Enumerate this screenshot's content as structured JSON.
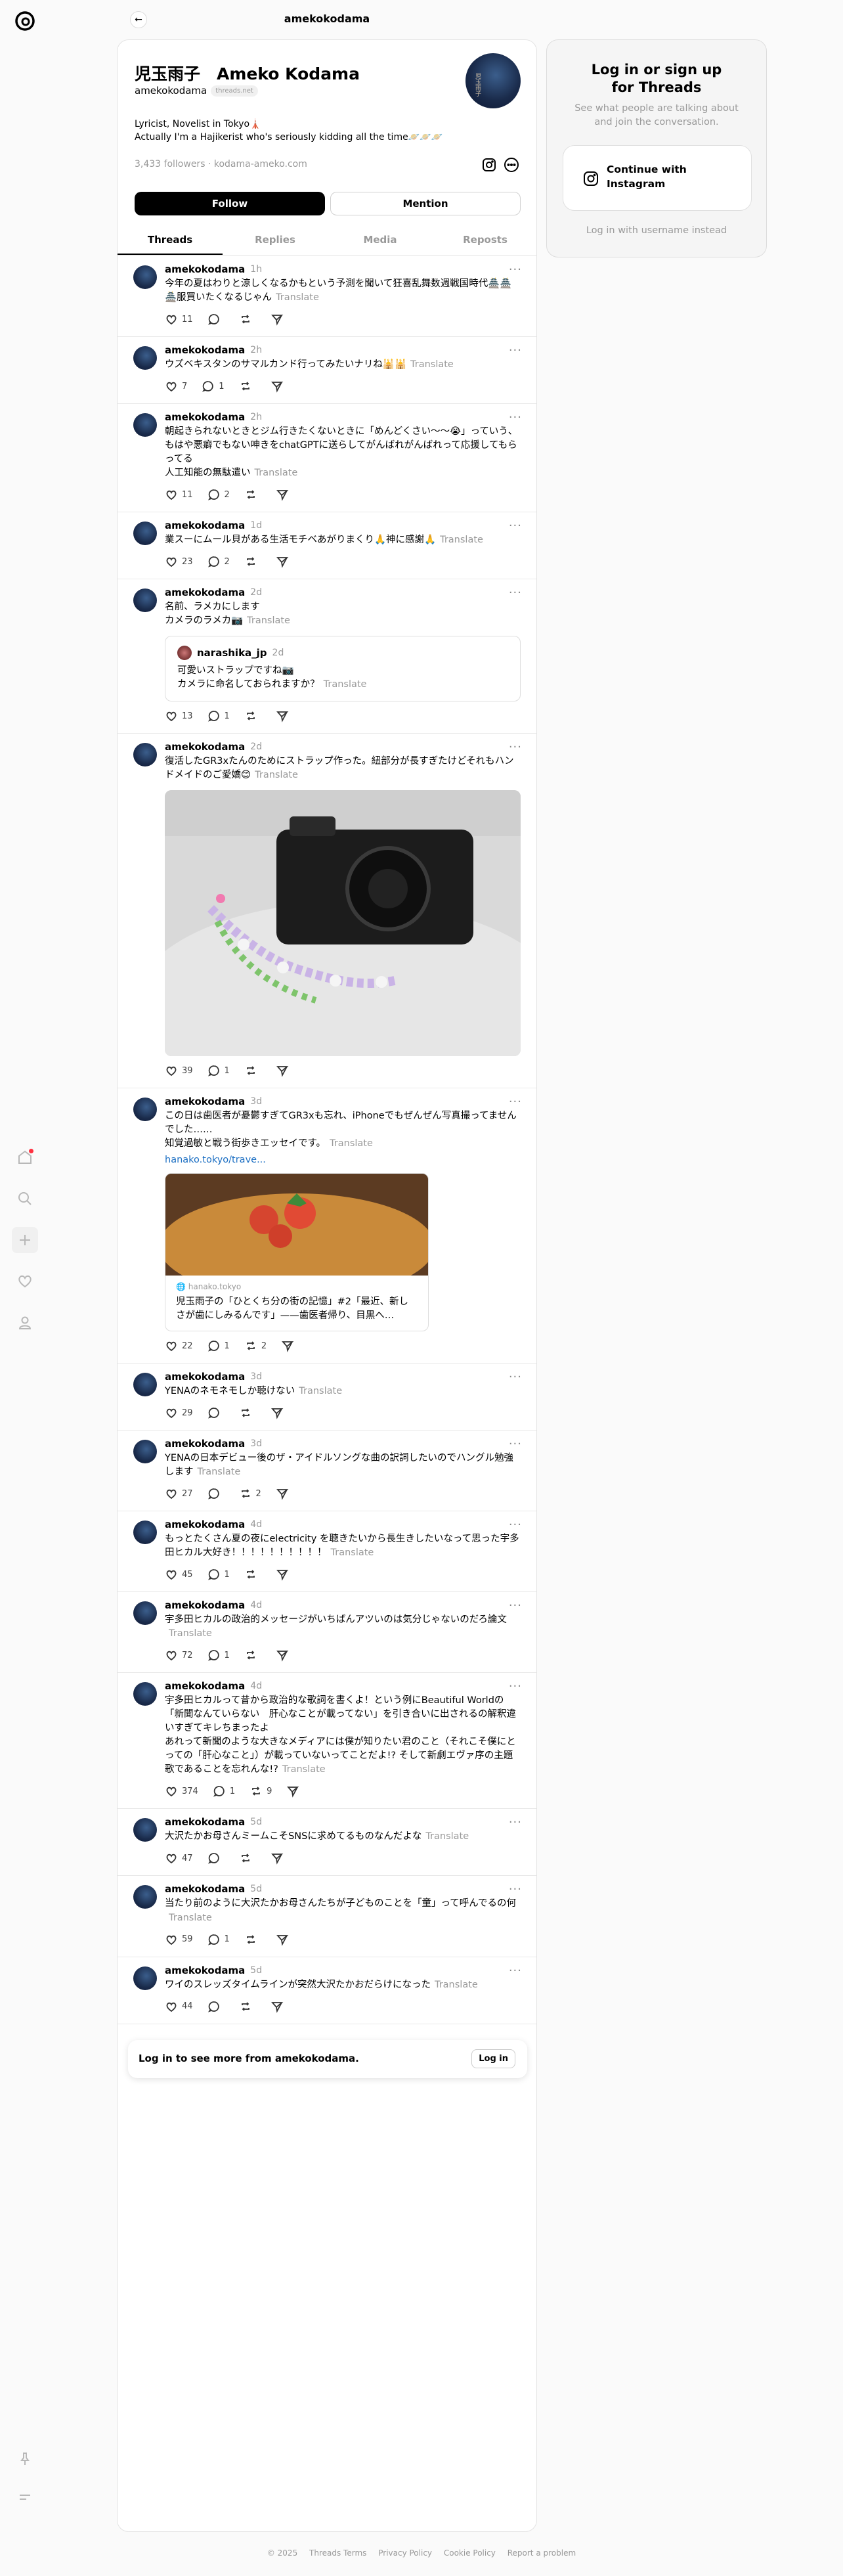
{
  "topbar": {
    "title": "amekokodama"
  },
  "profile": {
    "name": "児玉雨子　Ameko Kodama",
    "username": "amekokodama",
    "badge": "threads.net",
    "bio_line1": "Lyricist, Novelist in Tokyo🗼",
    "bio_line2": "Actually I'm a Hajikerist who's seriously kidding all the time🪐🪐🪐",
    "followers": "3,433 followers",
    "website": "kodama-ameko.com",
    "follow_label": "Follow",
    "mention_label": "Mention"
  },
  "tabs": [
    "Threads",
    "Replies",
    "Media",
    "Reposts"
  ],
  "translate_label": "Translate",
  "posts": [
    {
      "user": "amekokodama",
      "time": "1h",
      "text": "今年の夏はわりと涼しくなるかもという予測を聞いて狂喜乱舞数週戦国時代🏯🏯🏯服買いたくなるじゃん",
      "likes": "11",
      "replies": "",
      "reposts": ""
    },
    {
      "user": "amekokodama",
      "time": "2h",
      "text": "ウズベキスタンのサマルカンド行ってみたいナリね🕌🕌",
      "likes": "7",
      "replies": "1",
      "reposts": ""
    },
    {
      "user": "amekokodama",
      "time": "2h",
      "text": "朝起きられないときとジム行きたくないときに「めんどくさい〜〜😭」っていう、もはや悪癖でもない呻きをchatGPTに送らしてがんばれがんばれって応援してもらってる\n人工知能の無駄遣い",
      "likes": "11",
      "replies": "2",
      "reposts": ""
    },
    {
      "user": "amekokodama",
      "time": "1d",
      "text": "業スーにムール貝がある生活モチベあがりまくり🙏神に感謝🙏",
      "likes": "23",
      "replies": "2",
      "reposts": ""
    },
    {
      "user": "amekokodama",
      "time": "2d",
      "text": "名前、ラメカにします\nカメラのラメカ📷",
      "likes": "13",
      "replies": "1",
      "reposts": "",
      "quote": {
        "user": "narashika_jp",
        "time": "2d",
        "text": "可愛いストラップですね📷\nカメラに命名しておられますか？"
      }
    },
    {
      "user": "amekokodama",
      "time": "2d",
      "text": "復活したGR3xたんのためにストラップ作った。紐部分が長すぎたけどそれもハンドメイドのご愛嬌😊",
      "likes": "39",
      "replies": "1",
      "reposts": "",
      "photo": true
    },
    {
      "user": "amekokodama",
      "time": "3d",
      "text": "この日は歯医者が憂鬱すぎてGR3xも忘れ、iPhoneでもぜんぜん写真撮ってませんでした……\n知覚過敏と戦う街歩きエッセイです。",
      "likes": "22",
      "replies": "1",
      "reposts": "2",
      "link": "hanako.tokyo/trave...",
      "card": {
        "source": "hanako.tokyo",
        "title": "児玉雨子の「ひとくち分の街の記憶」#2「最近、新しさが歯にしみるんです」——歯医者帰り、目黒へ…"
      }
    },
    {
      "user": "amekokodama",
      "time": "3d",
      "text": "YENAのネモネモしか聴けない",
      "likes": "29",
      "replies": "",
      "reposts": ""
    },
    {
      "user": "amekokodama",
      "time": "3d",
      "text": "YENAの日本デビュー後のザ・アイドルソングな曲の訳詞したいのでハングル勉強します",
      "likes": "27",
      "replies": "",
      "reposts": "2"
    },
    {
      "user": "amekokodama",
      "time": "4d",
      "text": "もっとたくさん夏の夜にelectricity を聴きたいから長生きしたいなって思った宇多田ヒカル大好き！！！！！！！！！！",
      "likes": "45",
      "replies": "1",
      "reposts": ""
    },
    {
      "user": "amekokodama",
      "time": "4d",
      "text": "宇多田ヒカルの政治的メッセージがいちばんアツいのは気分じゃないのだろ論文",
      "likes": "72",
      "replies": "1",
      "reposts": ""
    },
    {
      "user": "amekokodama",
      "time": "4d",
      "text": "宇多田ヒカルって昔から政治的な歌詞を書くよ！という例にBeautiful Worldの「新聞なんていらない　肝心なことが載ってない」を引き合いに出されるの解釈違いすぎてキレちまったよ\nあれって新聞のような大きなメディアには僕が知りたい君のこと（それこそ僕にとっての「肝心なこと」）が載っていないってことだよ!? そして新劇エヴァ序の主題歌であることを忘れんな!?",
      "likes": "374",
      "replies": "1",
      "reposts": "9"
    },
    {
      "user": "amekokodama",
      "time": "5d",
      "text": "大沢たかお母さんミームこそSNSに求めてるものなんだよな",
      "likes": "47",
      "replies": "",
      "reposts": ""
    },
    {
      "user": "amekokodama",
      "time": "5d",
      "text": "当たり前のように大沢たかお母さんたちが子どものことを「童」って呼んでるの何",
      "likes": "59",
      "replies": "1",
      "reposts": ""
    },
    {
      "user": "amekokodama",
      "time": "5d",
      "text": "ワイのスレッズタイムラインが突然大沢たかおだらけになった",
      "likes": "44",
      "replies": "",
      "reposts": ""
    }
  ],
  "login_prompt": {
    "text": "Log in to see more from amekokodama.",
    "button": "Log in"
  },
  "sidebar": {
    "title_line1": "Log in or sign up",
    "title_line2": "for Threads",
    "subtitle": "See what people are talking about and join the conversation.",
    "button_line1": "Continue with",
    "button_line2": "Instagram",
    "alt_login": "Log in with username instead"
  },
  "footer": [
    "© 2025",
    "Threads Terms",
    "Privacy Policy",
    "Cookie Policy",
    "Report a problem"
  ]
}
